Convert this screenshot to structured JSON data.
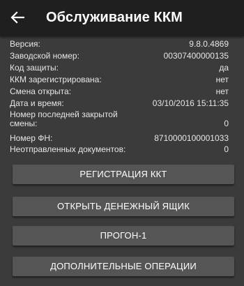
{
  "appbar": {
    "title": "Обслуживание ККМ"
  },
  "info_rows": [
    {
      "label": "Версия:",
      "value": "9.8.0.4869"
    },
    {
      "label": "Заводской номер:",
      "value": "00307400000135"
    },
    {
      "label": "Код защиты:",
      "value": "да"
    },
    {
      "label": "ККМ зарегистрирована:",
      "value": "нет"
    },
    {
      "label": "Смена открыта:",
      "value": "нет"
    },
    {
      "label": "Дата и время:",
      "value": "03/10/2016 15:11:35"
    },
    {
      "label": "Номер последней закрытой смены:",
      "value": "0"
    },
    {
      "label": "Номер ФН:",
      "value": "8710000100001033"
    },
    {
      "label": "Неотправленных документов:",
      "value": "0"
    }
  ],
  "buttons": {
    "register": "РЕГИСТРАЦИЯ ККТ",
    "open_drawer": "ОТКРЫТЬ ДЕНЕЖНЫЙ ЯЩИК",
    "run": "ПРОГОН-1",
    "more": "ДОПОЛНИТЕЛЬНЫЕ ОПЕРАЦИИ"
  }
}
